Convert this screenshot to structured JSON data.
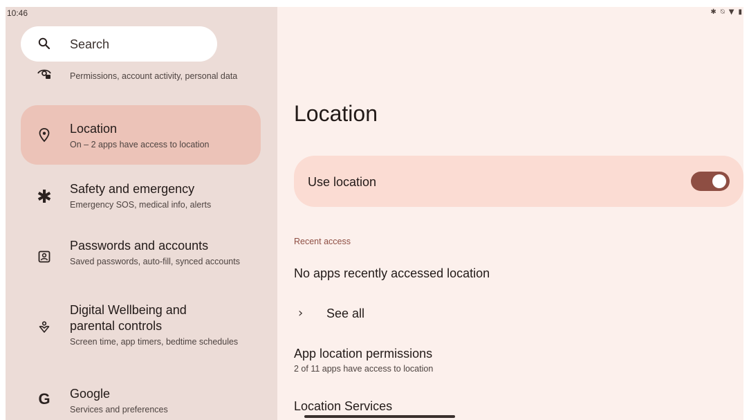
{
  "status_bar": {
    "time": "10:46",
    "icons": [
      "bluetooth-icon",
      "notifications-off-icon",
      "wifi-icon",
      "battery-icon"
    ]
  },
  "search": {
    "label": "Search"
  },
  "settings_list": {
    "items": [
      {
        "name": "privacy",
        "title": "",
        "subtitle": "Permissions, account activity, personal data",
        "icon": "eye-lock-icon",
        "selected": false
      },
      {
        "name": "location",
        "title": "Location",
        "subtitle": "On – 2 apps have access to location",
        "icon": "location-pin-icon",
        "selected": true
      },
      {
        "name": "safety",
        "title": "Safety and emergency",
        "subtitle": "Emergency SOS, medical info, alerts",
        "icon": "asterisk-icon",
        "selected": false
      },
      {
        "name": "passwords",
        "title": "Passwords and accounts",
        "subtitle": "Saved passwords, auto-fill, synced accounts",
        "icon": "account-box-icon",
        "selected": false
      },
      {
        "name": "wellbeing",
        "title": "Digital Wellbeing and parental controls",
        "subtitle": "Screen time, app timers, bedtime schedules",
        "icon": "wellbeing-icon",
        "selected": false
      },
      {
        "name": "google",
        "title": "Google",
        "subtitle": "Services and preferences",
        "icon": "google-g-icon",
        "selected": false
      }
    ]
  },
  "location_page": {
    "title": "Location",
    "use_location": {
      "label": "Use location",
      "enabled": true
    },
    "recent_access_header": "Recent access",
    "no_recent_text": "No apps recently accessed location",
    "see_all_label": "See all",
    "app_permissions": {
      "title": "App location permissions",
      "subtitle": "2 of 11 apps have access to location"
    },
    "location_services": {
      "title": "Location Services"
    }
  },
  "colors": {
    "left_pane_bg": "#ecdcd7",
    "right_pane_bg": "#fcf0ec",
    "selected_item_bg": "#ecc3b8",
    "use_location_card_bg": "#fbdcd3",
    "toggle_track": "#8e4e43",
    "accent_text": "#8e4e43"
  }
}
